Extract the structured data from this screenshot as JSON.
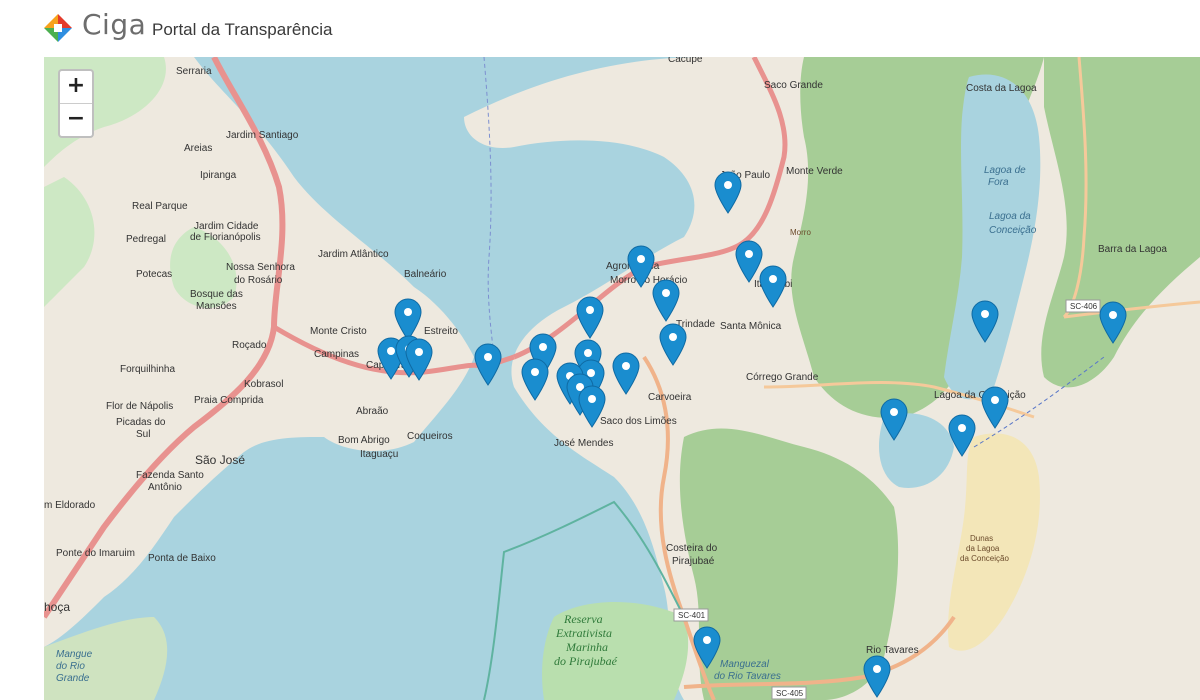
{
  "header": {
    "brand": "Ciga",
    "title": "Portal da Transparência"
  },
  "map": {
    "zoom_in_label": "+",
    "zoom_out_label": "−",
    "marker_color": "#1a8dcf",
    "marker_count": 28,
    "places": {
      "serraria": "Serraria",
      "jardim_santiago": "Jardim Santiago",
      "areias": "Areias",
      "ipiranga": "Ipiranga",
      "real_parque": "Real Parque",
      "jardim_cidade": "Jardim Cidade",
      "de_florianopolis": "de Florianópolis",
      "pedregal": "Pedregal",
      "jardim_atlantico": "Jardim Atlântico",
      "nossa_senhora": "Nossa Senhora",
      "do_rosario": "do Rosário",
      "balneario": "Balneário",
      "potecas": "Potecas",
      "bosque_das": "Bosque das",
      "mansoes": "Mansões",
      "monte_cristo": "Monte Cristo",
      "estreito": "Estreito",
      "rocado": "Roçado",
      "campinas": "Campinas",
      "capoeiras": "Capoeiras",
      "forquilhinha": "Forquilhinha",
      "kobrasol": "Kobrasol",
      "flor_de_napolis": "Flor de Nápolis",
      "praia_comprida": "Praia Comprida",
      "picadas_do": "Picadas do",
      "sul": "Sul",
      "abraao": "Abraão",
      "bom_abrigo": "Bom Abrigo",
      "coqueiros": "Coqueiros",
      "itaguacu": "Itaguaçu",
      "sao_jose": "São José",
      "fazenda_santo": "Fazenda Santo",
      "antonio": "Antônio",
      "jardim_eldorado": "m Eldorado",
      "ponte_do_imaruim": "Ponte do Imaruim",
      "ponta_de_baixo": "Ponta de Baixo",
      "palhoca": "hoça",
      "mangue_do_rio": "Mangue",
      "do_rio": "do Rio",
      "grande": "Grande",
      "cacupe": "Cacupé",
      "saco_grande": "Saco Grande",
      "joao_paulo": "João Paulo",
      "monte_verde": "Monte Verde",
      "agronomica": "Agronômica",
      "morro_do_horacio": "Morro do Horácio",
      "itacorubi": "Itacorubi",
      "trindade": "Trindade",
      "santa_monica": "Santa Mônica",
      "corrego_grande": "Córrego Grande",
      "carvoeira": "Carvoeira",
      "saco_dos_limoes": "Saco dos Limões",
      "jose_mendes": "José Mendes",
      "costeira_do": "Costeira do",
      "pirajuba": "Pirajubaé",
      "costa_da_lagoa": "Costa da Lagoa",
      "lagoa_de_fora": "Lagoa de",
      "fora": "Fora",
      "lagoa_da_conceicao_water": "Lagoa da",
      "conceicao": "Conceição",
      "barra_da_lagoa": "Barra da Lagoa",
      "lagoa_da_conceicao": "Lagoa da Conceição",
      "rio_tavares": "Rio Tavares",
      "reserva": "Reserva",
      "extrativista": "Extrativista",
      "marinha": "Marinha",
      "do_pirajuba": "do Pirajubaé",
      "dunas": "Dunas",
      "da_lagoa": "da Lagoa",
      "da_conceicao_dunas": "da Conceição",
      "manguezal": "Manguezal",
      "do_rio_tavares": "do Rio Tavares",
      "morro_da_fortaleza": "Morro",
      "sc_401": "SC-401",
      "sc_405": "SC-405",
      "sc_406": "SC-406"
    }
  }
}
